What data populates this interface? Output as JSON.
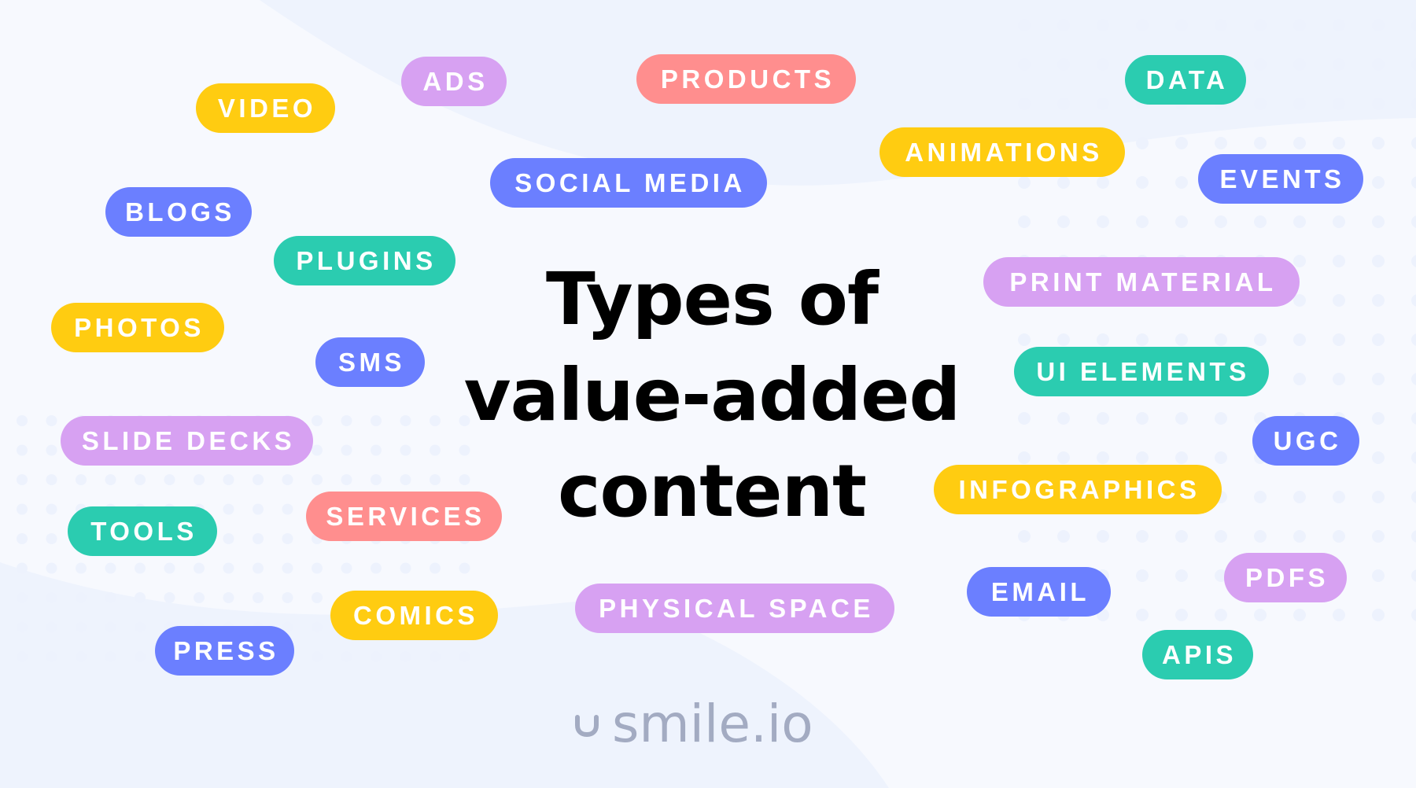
{
  "title": {
    "line1": "Types of",
    "line2": "value-added",
    "line3": "content"
  },
  "logo": {
    "icon": "smile-icon",
    "text": "smile.io"
  },
  "colors": {
    "yellow": "#ffcc11",
    "purple": "#d7a1f2",
    "coral": "#ff8e8e",
    "teal": "#2bccb0",
    "blue": "#6b7fff",
    "background": "#f7f9fe",
    "logo": "#a3abc2",
    "title": "#000000"
  },
  "tags": [
    {
      "label": "VIDEO",
      "color": "yellow"
    },
    {
      "label": "ADS",
      "color": "purple"
    },
    {
      "label": "PRODUCTS",
      "color": "coral"
    },
    {
      "label": "DATA",
      "color": "teal"
    },
    {
      "label": "ANIMATIONS",
      "color": "yellow"
    },
    {
      "label": "SOCIAL MEDIA",
      "color": "blue"
    },
    {
      "label": "EVENTS",
      "color": "blue"
    },
    {
      "label": "BLOGS",
      "color": "blue"
    },
    {
      "label": "PLUGINS",
      "color": "teal"
    },
    {
      "label": "PRINT MATERIAL",
      "color": "purple"
    },
    {
      "label": "PHOTOS",
      "color": "yellow"
    },
    {
      "label": "SMS",
      "color": "blue"
    },
    {
      "label": "UI ELEMENTS",
      "color": "teal"
    },
    {
      "label": "SLIDE DECKS",
      "color": "purple"
    },
    {
      "label": "UGC",
      "color": "blue"
    },
    {
      "label": "INFOGRAPHICS",
      "color": "yellow"
    },
    {
      "label": "SERVICES",
      "color": "coral"
    },
    {
      "label": "TOOLS",
      "color": "teal"
    },
    {
      "label": "EMAIL",
      "color": "blue"
    },
    {
      "label": "PDFS",
      "color": "purple"
    },
    {
      "label": "PHYSICAL SPACE",
      "color": "purple"
    },
    {
      "label": "COMICS",
      "color": "yellow"
    },
    {
      "label": "PRESS",
      "color": "blue"
    },
    {
      "label": "APIS",
      "color": "teal"
    }
  ]
}
